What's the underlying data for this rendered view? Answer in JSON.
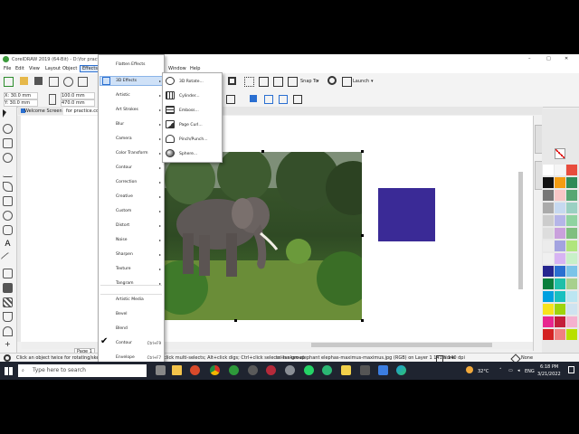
{
  "window": {
    "title": "CorelDRAW 2019 (64-Bit) - D:\\for practice.cdr*"
  },
  "menubar": {
    "items": [
      "File",
      "Edit",
      "View",
      "Layout",
      "Object",
      "Effects"
    ],
    "right_items": [
      "Window",
      "Help"
    ]
  },
  "toolbar": {
    "snap_label": "Snap To",
    "launch_label": "Launch"
  },
  "propbar": {
    "x": "X: 30.0 mm",
    "y": "Y: 30.0 mm",
    "w": "100.0 mm",
    "h": "470.0 mm"
  },
  "tabs": {
    "welcome": "Welcome Screen",
    "doc": "for practice.cdr*"
  },
  "effects_menu": {
    "items": [
      {
        "label": "Flatten Effects",
        "arrow": ""
      },
      {
        "label": "3D Effects",
        "arrow": "▸"
      },
      {
        "label": "Artistic",
        "arrow": "▸"
      },
      {
        "label": "Art Strokes",
        "arrow": "▸"
      },
      {
        "label": "Blur",
        "arrow": "▸"
      },
      {
        "label": "Camera",
        "arrow": "▸"
      },
      {
        "label": "Color Transform",
        "arrow": "▸"
      },
      {
        "label": "Contour",
        "arrow": "▸"
      },
      {
        "label": "Correction",
        "arrow": "▸"
      },
      {
        "label": "Creative",
        "arrow": "▸"
      },
      {
        "label": "Custom",
        "arrow": "▸"
      },
      {
        "label": "Distort",
        "arrow": "▸"
      },
      {
        "label": "Noise",
        "arrow": "▸"
      },
      {
        "label": "Sharpen",
        "arrow": "▸"
      },
      {
        "label": "Texture",
        "arrow": "▸"
      },
      {
        "label": "Tangram",
        "arrow": "▸"
      },
      {
        "label": "Artistic Media",
        "arrow": ""
      },
      {
        "label": "Bevel",
        "arrow": ""
      },
      {
        "label": "Blend",
        "arrow": ""
      },
      {
        "label": "Contour",
        "arrow": "Ctrl+F9"
      },
      {
        "label": "Envelope",
        "arrow": "Ctrl+F7"
      }
    ]
  },
  "submenu_3d": {
    "items": [
      "3D Rotate...",
      "Cylinder...",
      "Emboss...",
      "Page Curl...",
      "Pinch/Punch...",
      "Sphere..."
    ]
  },
  "status": {
    "left_hint": "Click an object twice for rotating/skewing; dbl",
    "mid_hint": "click multi-selects; Alt+click digs; Ctrl+click selects in a group",
    "object_info": "sri-lankan-elephant elephas-maximus-maximus.jpg (RGB) on Layer 1 141 x 140 dpi",
    "fill_none": "None",
    "outline_none": "None",
    "page_label": "Page 1"
  },
  "taskbar": {
    "search_placeholder": "Type here to search",
    "weather": "32°C",
    "lang": "ENG",
    "time": "6:18 PM",
    "date": "3/21/2022"
  },
  "colors": {
    "square": "#3a2a96",
    "accent": "#2a6fd1"
  }
}
